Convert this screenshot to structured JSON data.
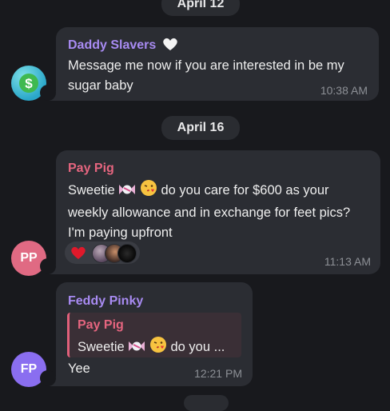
{
  "dates": {
    "first": "April 12",
    "second": "April 16"
  },
  "messages": [
    {
      "sender": "Daddy Slavers",
      "sender_color": "#a88bf2",
      "sender_badge": "white-heart-icon",
      "line1": "Message me now if you are interested in be my",
      "line2": "sugar baby",
      "time": "10:38 AM",
      "avatar_icon": "dollar-icon"
    },
    {
      "sender": "Pay Pig",
      "sender_color": "#e5657f",
      "line1_before": "Sweetie",
      "line1_after": "do you care for $600 as your",
      "line2": "weekly allowance and in exchange for feet pics?",
      "line3": "I'm paying upfront",
      "time": "11:13 AM",
      "avatar_initials": "PP",
      "avatar_color": "#e06a83",
      "reactions": [
        "red-heart-icon",
        "user-avatar",
        "user-avatar",
        "user-avatar"
      ]
    },
    {
      "sender": "Feddy Pinky",
      "sender_color": "#a88bf2",
      "reply_sender": "Pay Pig",
      "reply_before": "Sweetie",
      "reply_after": "do you ...",
      "text": "Yee",
      "time": "12:21 PM",
      "avatar_initials": "FP",
      "avatar_color": "#8a6ef0"
    }
  ]
}
